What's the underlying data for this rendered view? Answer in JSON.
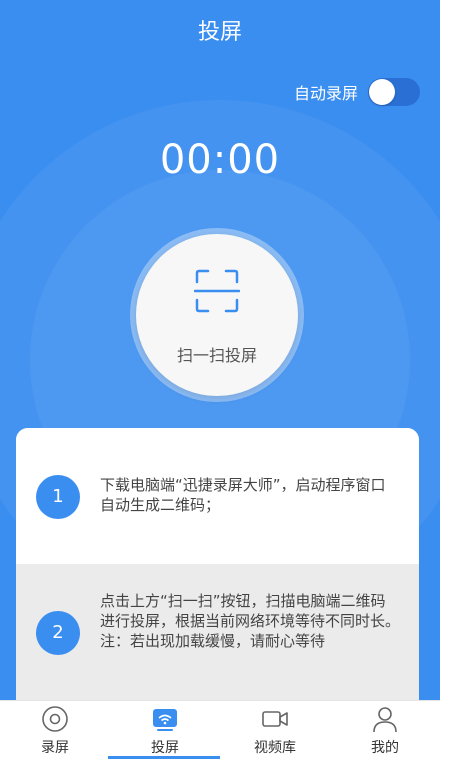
{
  "header": {
    "title": "投屏"
  },
  "auto_record": {
    "label": "自动录屏",
    "enabled": false
  },
  "timer": {
    "value": "00:00"
  },
  "scan_button": {
    "label": "扫一扫投屏",
    "icon": "scan-icon"
  },
  "steps": [
    {
      "number": "1",
      "text": "下载电脑端“迅捷录屏大师”，启动程序窗口自动生成二维码；"
    },
    {
      "number": "2",
      "text": "点击上方“扫一扫”按钮，扫描电脑端二维码进行投屏，根据当前网络环境等待不同时长。 注：若出现加载缓慢，请耐心等待"
    }
  ],
  "tabbar": {
    "active": "投屏",
    "items": [
      {
        "label": "录屏",
        "icon": "record-icon"
      },
      {
        "label": "投屏",
        "icon": "cast-icon"
      },
      {
        "label": "视频库",
        "icon": "video-icon"
      },
      {
        "label": "我的",
        "icon": "user-icon"
      }
    ]
  },
  "colors": {
    "primary": "#3a8ef0",
    "toggle_track": "#2a6fd4"
  }
}
